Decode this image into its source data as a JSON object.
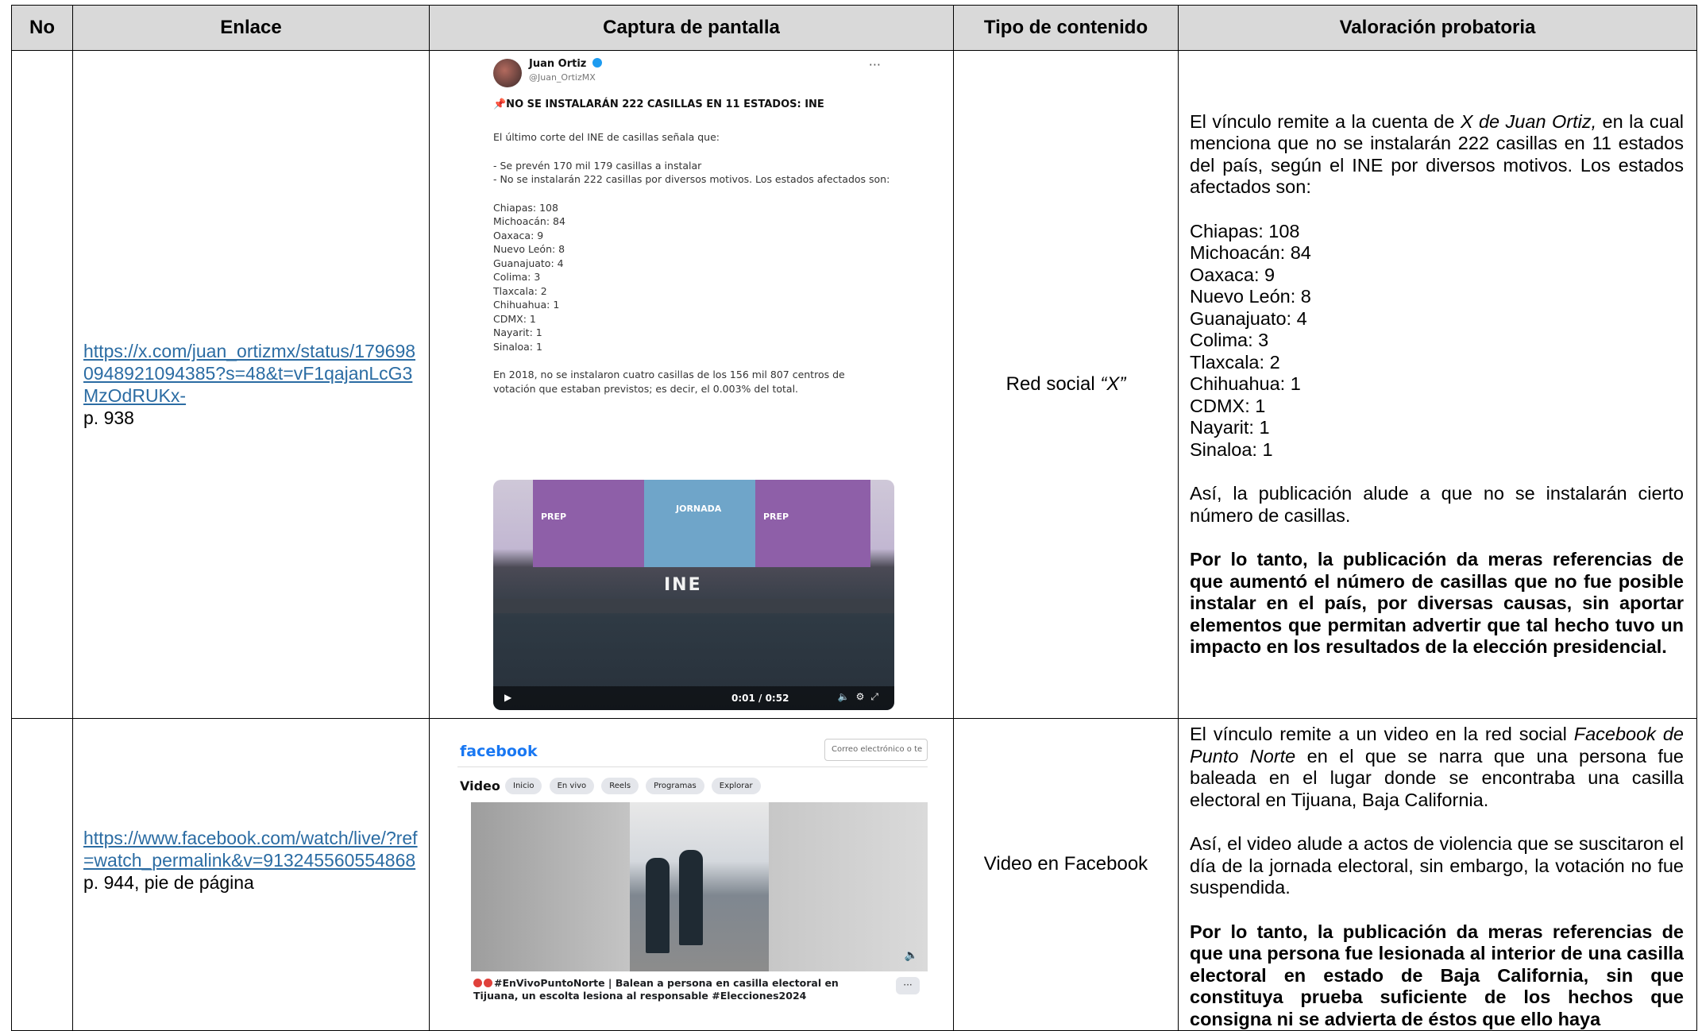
{
  "table": {
    "headers": [
      "No",
      "Enlace",
      "Captura de pantalla",
      "Tipo de contenido",
      "Valoración probatoria"
    ],
    "rows": [
      {
        "link": "https://x.com/juan_ortizmx/status/1796980948921094385?s=48&t=vF1qajanLcG3MzOdRUKx-",
        "page": "p. 938",
        "type_prefix": "Red social ",
        "type_em": "“X”",
        "val": {
          "p1_a": "El vínculo remite a la cuenta de ",
          "p1_em": "X de Juan Ortiz,",
          "p1_b": " en la cual menciona que no se instalarán 222 casillas en 11 estados del país, según el INE por diversos motivos. Los estados afectados son:",
          "states": [
            "Chiapas: 108",
            "Michoacán: 84",
            "Oaxaca: 9",
            "Nuevo León: 8",
            "Guanajuato: 4",
            "Colima: 3",
            "Tlaxcala: 2",
            "Chihuahua: 1",
            "CDMX: 1",
            "Nayarit: 1",
            "Sinaloa: 1"
          ],
          "p2": "Así, la publicación alude a que no se instalarán cierto número de casillas.",
          "p3_bold": "Por lo tanto, la publicación da meras referencias de que aumentó el número de casillas que no fue posible instalar en el país, por diversas causas, sin aportar elementos que permitan advertir que tal hecho tuvo un impacto en los resultados de la elección presidencial."
        },
        "tweet": {
          "name": "Juan Ortiz",
          "handle": "@Juan_OrtizMX",
          "more": "···",
          "title": "📌NO SE INSTALARÁN 222 CASILLAS EN 11 ESTADOS: INE",
          "l1": "El último corte del INE de casillas señala que:",
          "l2": "- Se prevén 170 mil 179 casillas a instalar",
          "l3": "- No se instalarán 222 casillas por diversos motivos. Los estados afectados son:",
          "states": [
            "Chiapas: 108",
            "Michoacán: 84",
            "Oaxaca: 9",
            "Nuevo León: 8",
            "Guanajuato: 4",
            "Colima: 3",
            "Tlaxcala: 2",
            "Chihuahua: 1",
            "CDMX: 1",
            "Nayarit: 1",
            "Sinaloa: 1"
          ],
          "l4": "En 2018, no se instalaron cuatro casillas de los 156 mil 807 centros de votación que estaban previstos; es decir, el 0.003% del total.",
          "video": {
            "prep": "PREP",
            "jornada": "JORNADA",
            "ine": "INE",
            "time": "0:01 / 0:52",
            "play": "▶",
            "icons": "🔈⚙⤢"
          }
        }
      },
      {
        "link": "https://www.facebook.com/watch/live/?ref=watch_permalink&v=913245560554868",
        "page": "p. 944, pie de página",
        "type": "Video en Facebook",
        "val": {
          "p1_a": "El vínculo remite a un video en la red social ",
          "p1_em": "Facebook de Punto Norte",
          "p1_b": " en el que se narra que una persona fue baleada en el lugar donde se encontraba una casilla electoral en Tijuana, Baja California.",
          "p2": "Así, el video alude a actos de violencia que se suscitaron el día de la jornada electoral, sin embargo, la votación no fue suspendida.",
          "p3_bold": "Por lo tanto, la publicación da meras referencias de que una persona fue lesionada al interior de una casilla electoral en estado de Baja California, sin que constituya prueba suficiente de los hechos que consigna ni se advierta de éstos que ello haya"
        },
        "fb": {
          "logo": "facebook",
          "email_placeholder": "Correo electrónico o te",
          "video_label": "Video",
          "tabs": [
            "Inicio",
            "En vivo",
            "Reels",
            "Programas",
            "Explorar"
          ],
          "caption": "#EnVivoPuntoNorte | Balean a persona en casilla electoral en Tijuana, un escolta lesiona al responsable #Elecciones2024",
          "more": "···",
          "volume": "🔈"
        }
      }
    ]
  },
  "colors": {
    "link": "#2b6ca3",
    "header_bg": "#d9d9d9",
    "fb_blue": "#1877f2",
    "tw_verified": "#1d9bf0"
  }
}
